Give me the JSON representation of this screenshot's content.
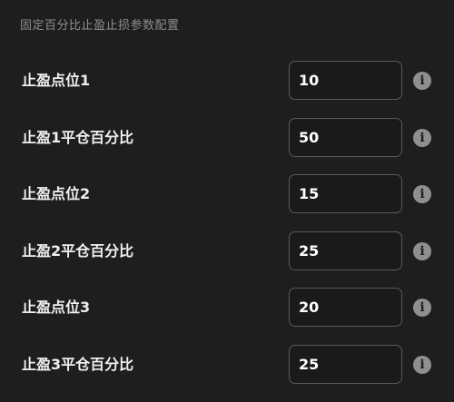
{
  "section": {
    "title": "固定百分比止盈止损参数配置"
  },
  "rows": [
    {
      "label": "止盈点位1",
      "value": "10"
    },
    {
      "label": "止盈1平仓百分比",
      "value": "50"
    },
    {
      "label": "止盈点位2",
      "value": "15"
    },
    {
      "label": "止盈2平仓百分比",
      "value": "25"
    },
    {
      "label": "止盈点位3",
      "value": "20"
    },
    {
      "label": "止盈3平仓百分比",
      "value": "25"
    }
  ],
  "icons": {
    "info": "info-icon",
    "info_glyph": "i"
  },
  "colors": {
    "background": "#1e1e1e",
    "input_border": "#5a5a5a",
    "info_icon": "#8f8f8f",
    "title_text": "#8e8e8e"
  }
}
